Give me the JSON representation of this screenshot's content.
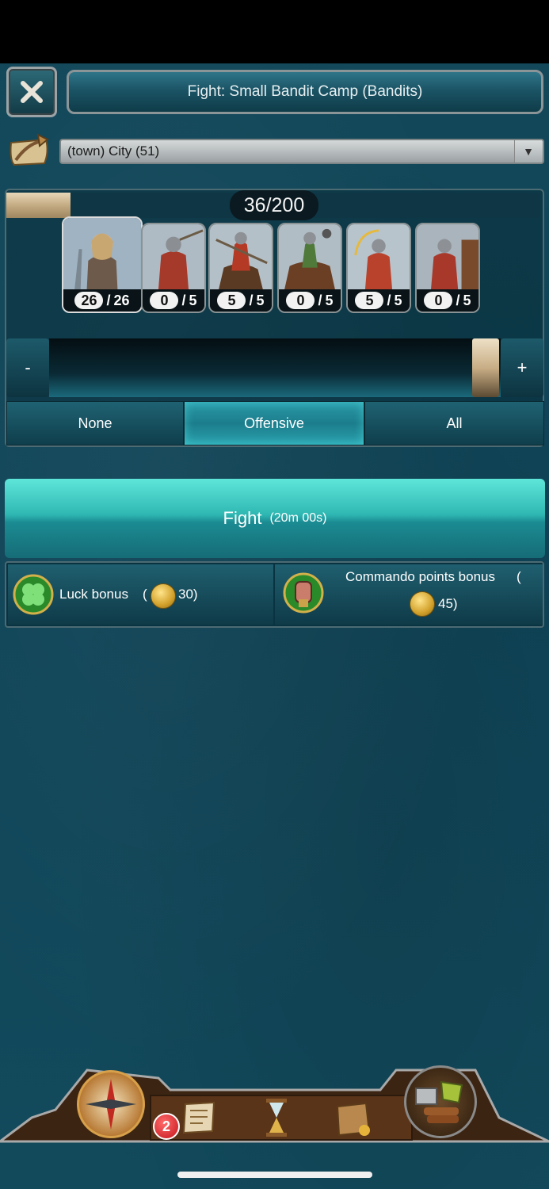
{
  "header": {
    "title": "Fight: Small Bandit Camp (Bandits)",
    "close_icon": "close-icon"
  },
  "town": {
    "selected": "(town) City (51)",
    "icon": "travel-scroll-icon"
  },
  "army": {
    "capacity_text": "36/200",
    "capacity_fraction": 0.18,
    "units": [
      {
        "name": "hero-general",
        "current": "26",
        "max": "26"
      },
      {
        "name": "swordsman",
        "current": "0",
        "max": "5"
      },
      {
        "name": "lancer-cavalry",
        "current": "5",
        "max": "5"
      },
      {
        "name": "mace-cavalry",
        "current": "0",
        "max": "5"
      },
      {
        "name": "archer",
        "current": "5",
        "max": "5"
      },
      {
        "name": "crossbowman",
        "current": "0",
        "max": "5"
      }
    ],
    "slider_fraction": 1.0,
    "minus_label": "-",
    "plus_label": "+"
  },
  "filters": {
    "none": "None",
    "offensive": "Offensive",
    "all": "All",
    "active": "offensive"
  },
  "fight": {
    "label": "Fight",
    "time": "(20m 00s)"
  },
  "bonuses": {
    "luck_label": "Luck bonus",
    "luck_open": "(",
    "luck_cost": "30)",
    "commando_label": "Commando points bonus",
    "commando_open": "(",
    "commando_cost": "45)"
  },
  "bottom": {
    "notification_count": "2",
    "icons": [
      "compass-icon",
      "scroll-icon",
      "hourglass-icon",
      "backpack-icon",
      "resources-icon"
    ]
  }
}
